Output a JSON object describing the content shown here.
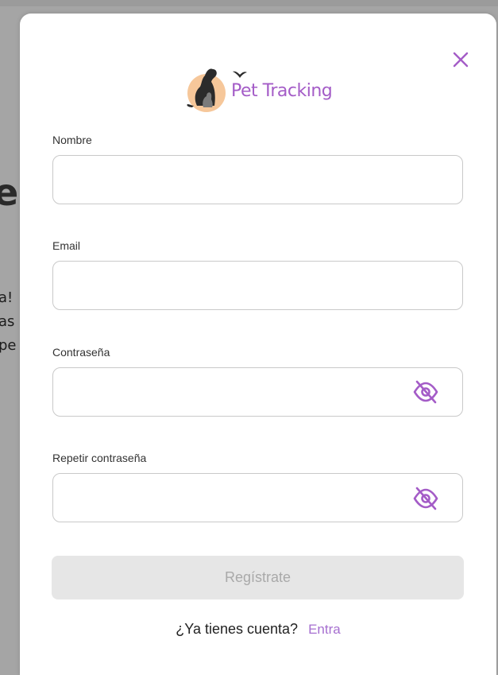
{
  "background": {
    "heading_fragment": "e",
    "text_fragments": [
      "a!",
      "as",
      "pe"
    ]
  },
  "modal": {
    "close_icon": "close-icon",
    "logo": {
      "text": "Pet Tracking",
      "icon": "dog-cat-logo-icon"
    },
    "fields": {
      "name": {
        "label": "Nombre",
        "value": "",
        "placeholder": ""
      },
      "email": {
        "label": "Email",
        "value": "",
        "placeholder": ""
      },
      "password": {
        "label": "Contraseña",
        "value": "",
        "placeholder": "",
        "toggle_icon": "eye-off-icon"
      },
      "repeat_password": {
        "label": "Repetir contraseña",
        "value": "",
        "placeholder": "",
        "toggle_icon": "eye-off-icon"
      }
    },
    "submit_label": "Regístrate",
    "footer": {
      "prompt": "¿Ya tienes cuenta?",
      "link": "Entra"
    }
  },
  "colors": {
    "accent": "#a45cc7",
    "overlay": "#a5a5a5",
    "button_disabled_bg": "#e6e6e6",
    "button_disabled_text": "#a9a9a9"
  }
}
